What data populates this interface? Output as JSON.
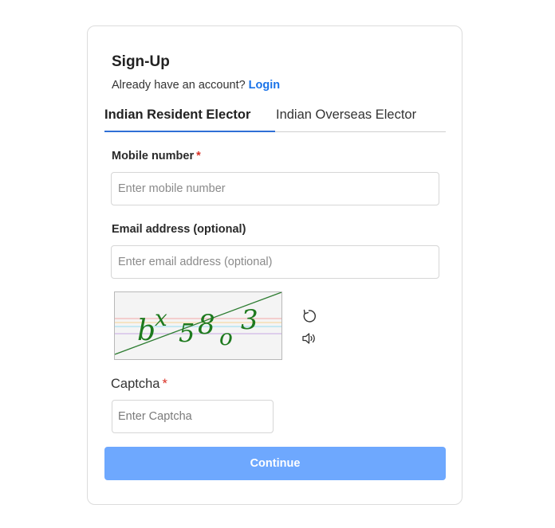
{
  "form": {
    "title": "Sign-Up",
    "account_prompt": "Already have an account?",
    "login_link": "Login"
  },
  "tabs": [
    {
      "label": "Indian Resident Elector",
      "active": true
    },
    {
      "label": "Indian Overseas Elector",
      "active": false
    }
  ],
  "fields": {
    "mobile": {
      "label": "Mobile number",
      "required_marker": "*",
      "value": "",
      "placeholder": "Enter mobile number"
    },
    "email": {
      "label": "Email address (optional)",
      "value": "",
      "placeholder": "Enter email address (optional)"
    },
    "captcha": {
      "label": "Captcha",
      "required_marker": "*",
      "value": "",
      "placeholder": "Enter Captcha"
    }
  },
  "captcha_image": {
    "text": "bx58o3",
    "text_color": "#1e7a1e",
    "refresh_icon": "refresh-icon",
    "audio_icon": "speaker-icon"
  },
  "actions": {
    "continue_label": "Continue"
  },
  "colors": {
    "link": "#1a73e8",
    "active_tab_underline": "#2f6fd6",
    "required": "#d93025",
    "continue_button": "#6ea8fe"
  }
}
